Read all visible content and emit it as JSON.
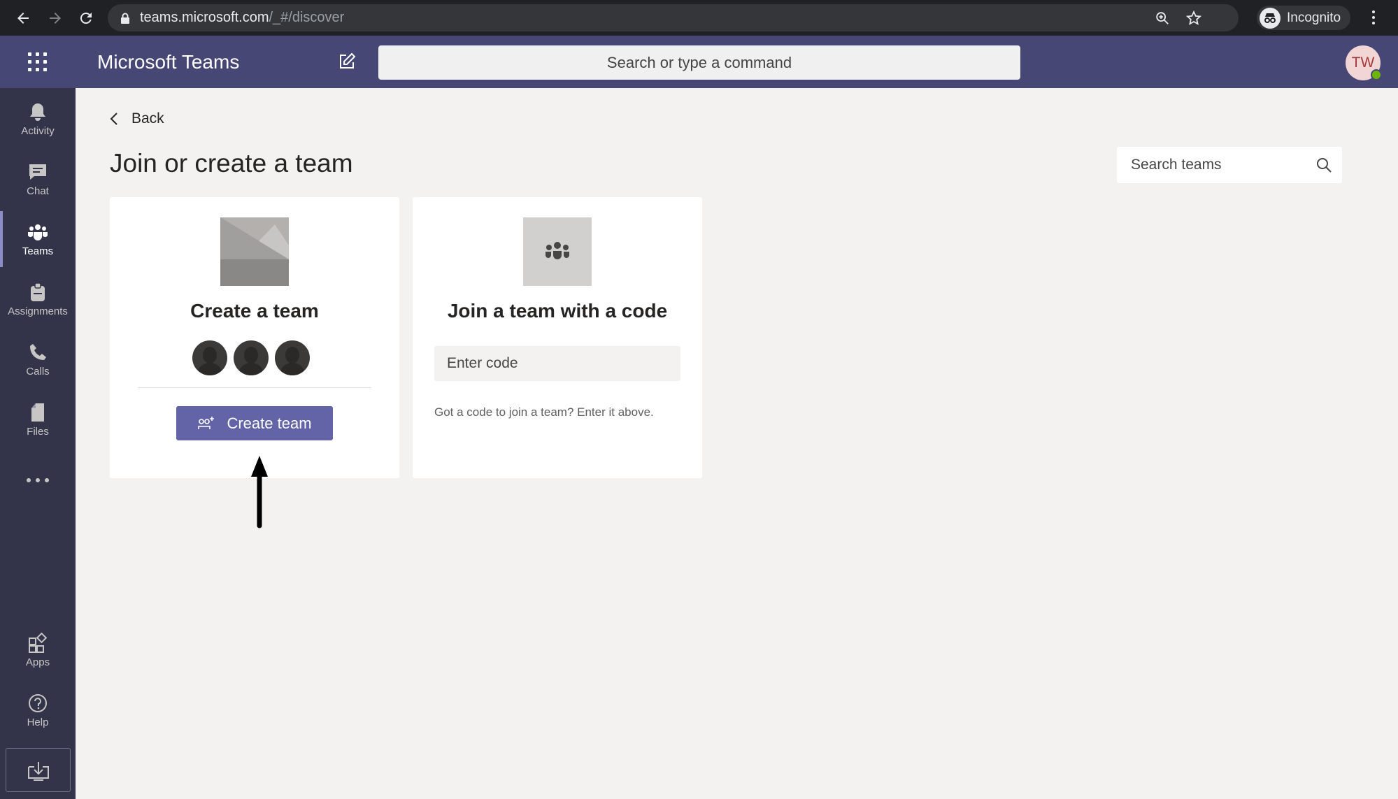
{
  "browser": {
    "url_host": "teams.microsoft.com",
    "url_path": "/_#/discover",
    "profile_label": "Incognito"
  },
  "header": {
    "app_title": "Microsoft Teams",
    "search_placeholder": "Search or type a command",
    "avatar_initials": "TW"
  },
  "rail": {
    "items": [
      {
        "label": "Activity",
        "icon": "bell-icon"
      },
      {
        "label": "Chat",
        "icon": "chat-icon"
      },
      {
        "label": "Teams",
        "icon": "teams-icon",
        "active": true
      },
      {
        "label": "Assignments",
        "icon": "assignments-icon"
      },
      {
        "label": "Calls",
        "icon": "phone-icon"
      },
      {
        "label": "Files",
        "icon": "file-icon"
      }
    ],
    "bottom": [
      {
        "label": "Apps",
        "icon": "apps-icon"
      },
      {
        "label": "Help",
        "icon": "help-icon"
      }
    ]
  },
  "main": {
    "back_label": "Back",
    "page_title": "Join or create a team",
    "search_teams_placeholder": "Search teams",
    "create_card": {
      "title": "Create a team",
      "button_label": "Create team"
    },
    "join_card": {
      "title": "Join a team with a code",
      "code_placeholder": "Enter code",
      "help_text": "Got a code to join a team? Enter it above."
    }
  },
  "colors": {
    "header_bg": "#464775",
    "rail_bg": "#33344a",
    "accent": "#6264a7",
    "page_bg": "#f3f2f1"
  }
}
